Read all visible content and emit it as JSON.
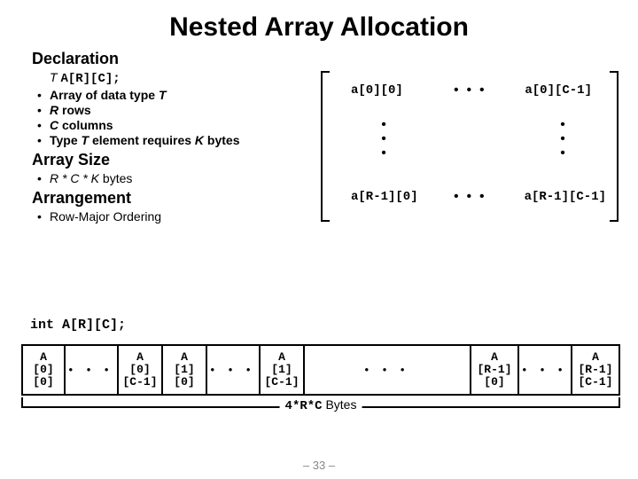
{
  "title": "Nested Array Allocation",
  "sections": {
    "declaration": {
      "heading": "Declaration",
      "decl_T": "T",
      "decl_code": "A[R][C];",
      "items": [
        {
          "pre": "Array of data type ",
          "post": "T"
        },
        {
          "pre": "",
          "post": "R rows",
          "plain": " rows",
          "em": "R"
        },
        {
          "pre": "",
          "post": "C columns",
          "plain": " columns",
          "em": "C"
        },
        {
          "pre": "Type ",
          "mid": "T",
          "rest": " element requires ",
          "k": "K",
          "tail": " bytes"
        }
      ]
    },
    "arraysize": {
      "heading": "Array Size",
      "formula": "R * C * K",
      "bytes": " bytes"
    },
    "arrangement": {
      "heading": "Arrangement",
      "item": "Row-Major Ordering"
    }
  },
  "matrix": {
    "tl": "a[0][0]",
    "tr": "a[0][C-1]",
    "bl": "a[R-1][0]",
    "br": "a[R-1][C-1]"
  },
  "memory": {
    "decl": "int A[R][C];",
    "cells": [
      "A\n[0]\n[0]",
      "• • •",
      "A\n[0]\n[C-1]",
      "A\n[1]\n[0]",
      "• • •",
      "A\n[1]\n[C-1]",
      "•   •   •",
      "A\n[R-1]\n[0]",
      "• • •",
      "A\n[R-1]\n[C-1]"
    ],
    "brace_label_code": "4*R*C",
    "brace_label_rest": " Bytes"
  },
  "pagenum": "– 33 –"
}
